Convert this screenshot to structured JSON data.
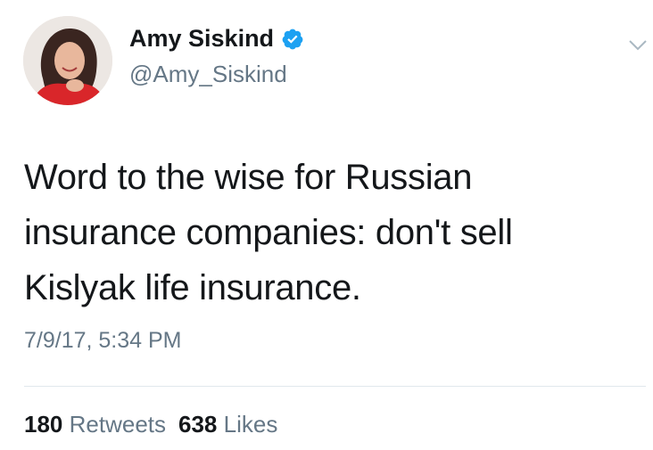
{
  "author": {
    "display_name": "Amy Siskind",
    "handle": "@Amy_Siskind",
    "verified": true,
    "avatar_icon": "profile-photo"
  },
  "tweet": {
    "lines": [
      "Word to the wise for Russian",
      "insurance companies: don't sell",
      "Kislyak life insurance."
    ],
    "timestamp": "7/9/17, 5:34 PM"
  },
  "stats": {
    "retweets_count": "180",
    "retweets_label": "Retweets",
    "likes_count": "638",
    "likes_label": "Likes"
  },
  "colors": {
    "verified_blue": "#1da1f2",
    "secondary_text": "#657786",
    "primary_text": "#14171a"
  }
}
